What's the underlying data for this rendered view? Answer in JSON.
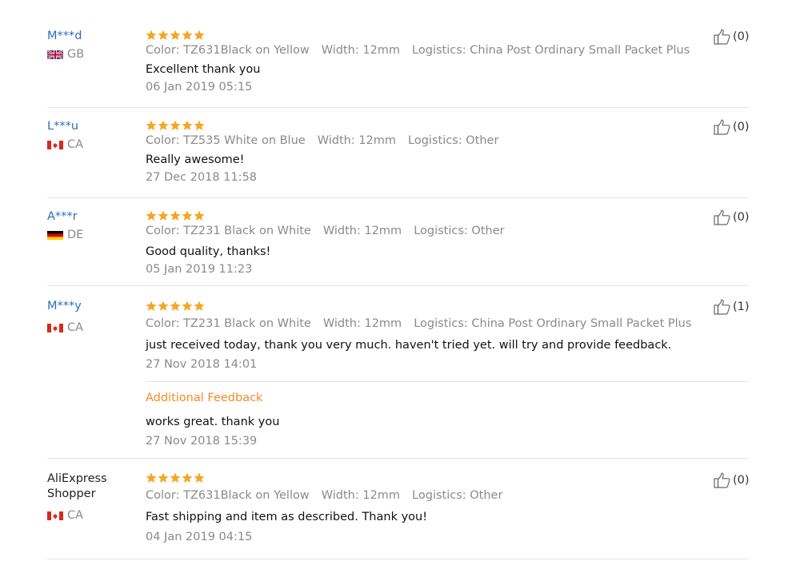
{
  "reviews": [
    {
      "buyer": "M***d",
      "country": "GB",
      "rating": 5,
      "attrs": [
        "Color: TZ631Black on Yellow",
        "Width: 12mm",
        "Logistics: China Post Ordinary Small Packet Plus"
      ],
      "content": "Excellent thank you",
      "date": "06 Jan 2019 05:15",
      "helpful": "(0)"
    },
    {
      "buyer": "L***u",
      "country": "CA",
      "rating": 5,
      "attrs": [
        "Color: TZ535 White on Blue",
        "Width: 12mm",
        "Logistics: Other"
      ],
      "content": "Really awesome!",
      "date": "27 Dec 2018 11:58",
      "helpful": "(0)"
    },
    {
      "buyer": "A***r",
      "country": "DE",
      "rating": 5,
      "attrs": [
        "Color: TZ231 Black on White",
        "Width: 12mm",
        "Logistics: Other"
      ],
      "content": "Good quality, thanks!",
      "date": "05 Jan 2019 11:23",
      "helpful": "(0)"
    },
    {
      "buyer": "M***y",
      "country": "CA",
      "rating": 5,
      "attrs": [
        "Color: TZ231 Black on White",
        "Width: 12mm",
        "Logistics: China Post Ordinary Small Packet Plus"
      ],
      "content": "just received today, thank you very much. haven't tried yet. will try and provide feedback.",
      "date": "27 Nov 2018 14:01",
      "helpful": "(1)",
      "additional": {
        "label": "Additional Feedback",
        "content": "works great. thank you",
        "date": "27 Nov 2018 15:39"
      }
    },
    {
      "buyer": "AliExpress Shopper",
      "country": "CA",
      "rating": 5,
      "attrs": [
        "Color: TZ631Black on Yellow",
        "Width: 12mm",
        "Logistics: Other"
      ],
      "content": "Fast shipping and item as described. Thank you!",
      "date": "04 Jan 2019 04:15",
      "helpful": "(0)"
    }
  ],
  "colors": {
    "star": "#f5a623",
    "link": "#2a6fbf",
    "muted": "#8a8a8a",
    "additional_label": "#f08c24",
    "divider": "#e6e6e6"
  },
  "icons": {
    "helpful": "thumbs-up-icon",
    "rating": "star-icon"
  }
}
